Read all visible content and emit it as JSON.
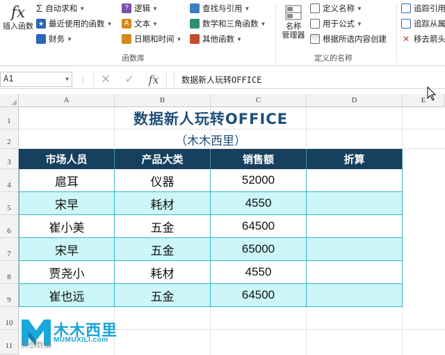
{
  "ribbon": {
    "insert_function": "插入函数",
    "library": {
      "autosum": "自动求和",
      "recent": "最近使用的函数",
      "finance": "财务",
      "logic": "逻辑",
      "text": "文本",
      "datetime": "日期和时间",
      "lookup": "查找与引用",
      "math": "数学和三角函数",
      "other": "其他函数",
      "group_label": "函数库"
    },
    "names": {
      "name_manager": "名称\n管理器",
      "name_manager_l1": "名称",
      "name_manager_l2": "管理器",
      "define_name": "定义名称",
      "use_in_formula": "用于公式",
      "create_from_selection": "根据所选内容创建",
      "group_label": "定义的名称"
    },
    "audit": {
      "trace_precedents": "追踪引用",
      "trace_dependents": "追踪从属",
      "remove_arrows": "移去箭头"
    }
  },
  "formula_bar": {
    "name_box": "A1",
    "formula": "数据新人玩转OFFICE"
  },
  "columns": [
    "A",
    "B",
    "C",
    "D",
    "E"
  ],
  "rows": [
    "1",
    "2",
    "3",
    "4",
    "5",
    "6",
    "7",
    "8",
    "9",
    "10",
    "11"
  ],
  "sheet": {
    "title": "数据新人玩转OFFICE",
    "subtitle": "（木木西里）",
    "headers": [
      "市场人员",
      "产品大类",
      "销售额",
      "折算"
    ],
    "data": [
      [
        "扈耳",
        "仪器",
        "52000",
        ""
      ],
      [
        "宋早",
        "耗材",
        "4550",
        ""
      ],
      [
        "崔小美",
        "五金",
        "64500",
        ""
      ],
      [
        "宋早",
        "五金",
        "65000",
        ""
      ],
      [
        "贾尧小",
        "耗材",
        "4550",
        ""
      ],
      [
        "崔也远",
        "五金",
        "64500",
        ""
      ]
    ]
  },
  "watermark": {
    "brand": "木木西里",
    "url": "MUMUXILI.com",
    "bottom": "灵感数据"
  },
  "colors": {
    "header_bg": "#17405e",
    "alt_row": "#ccf6f8",
    "border": "#32b6c4",
    "title": "#1f4e79"
  }
}
